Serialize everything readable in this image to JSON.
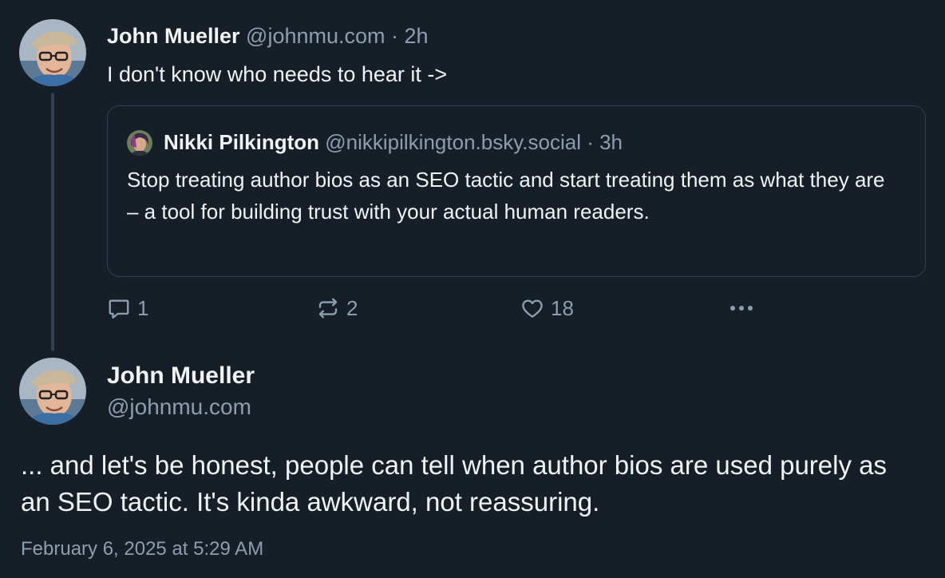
{
  "colors": {
    "background": "#161e27",
    "text": "#f1f3f5",
    "muted": "#8d9eb0",
    "border": "#2e4052"
  },
  "parent_post": {
    "author_name": "John Mueller",
    "author_handle": "@johnmu.com",
    "separator": " · ",
    "timestamp": "2h",
    "text": "I don't know who needs to hear it ->",
    "avatar_icon": "avatar-photo",
    "quoted_post": {
      "author_name": "Nikki Pilkington",
      "author_handle": "@nikkipilkington.bsky.social",
      "separator": " · ",
      "timestamp": "3h",
      "text": "Stop treating author bios as an SEO tactic and start treating them as what they are – a tool for building trust with your actual human readers.",
      "avatar_icon": "avatar-photo"
    },
    "actions": {
      "reply_count": "1",
      "repost_count": "2",
      "like_count": "18",
      "reply_icon": "comment-icon",
      "repost_icon": "repost-icon",
      "like_icon": "heart-icon",
      "more_icon": "more-horizontal-icon"
    }
  },
  "main_post": {
    "author_name": "John Mueller",
    "author_handle": "@johnmu.com",
    "text": "... and let's be honest, people can tell when author bios are used purely as an SEO tactic. It's kinda awkward, not reassuring.",
    "timestamp": "February 6, 2025 at 5:29 AM",
    "avatar_icon": "avatar-photo"
  }
}
